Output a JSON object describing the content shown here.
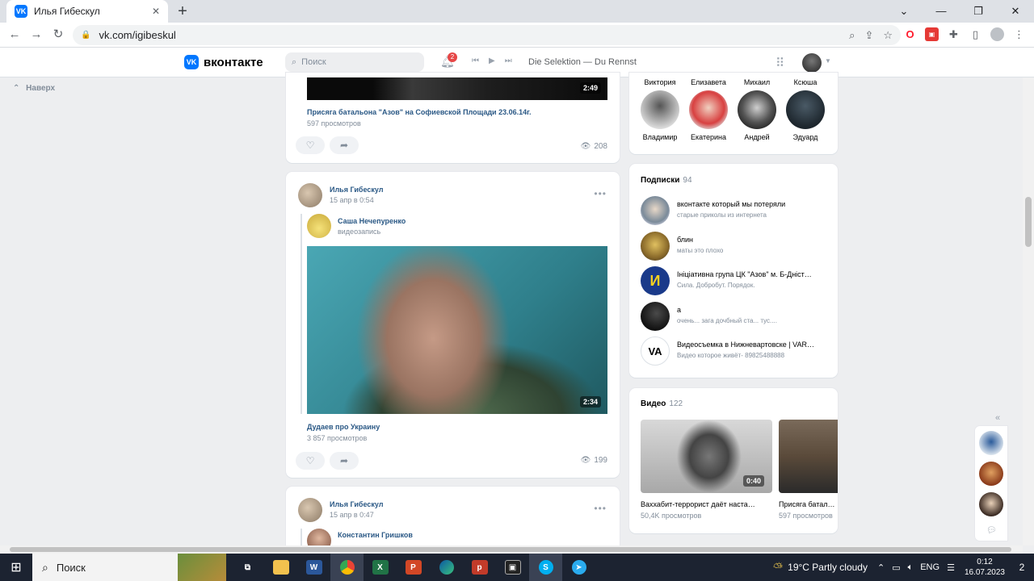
{
  "browser": {
    "tab_title": "Илья Гибескул",
    "tab_favicon": "VK",
    "url": "vk.com/igibeskul",
    "colors": {
      "tabbar": "#dee1e6",
      "omnibox": "#f1f3f4"
    }
  },
  "header": {
    "logo_text": "вконтакте",
    "logo_mark": "VK",
    "search_placeholder": "Поиск",
    "notifications_count": "2",
    "now_playing": "Die Selektion — Du Rennst",
    "accent": "#0077ff"
  },
  "left_nav": {
    "back_to_top": "Наверх"
  },
  "posts": [
    {
      "video_duration": "2:49",
      "video_title": "Присяга батальона \"Азов\" на Софиевской Площади 23.06.14г.",
      "video_views": "597 просмотров",
      "views": "208"
    },
    {
      "author": "Илья Гибескул",
      "date": "15 апр в 0:54",
      "repost_author": "Саша Нечепуренко",
      "repost_type": "видеозапись",
      "video_duration": "2:34",
      "video_title": "Дудаев про Украину",
      "video_views": "3 857 просмотров",
      "views": "199"
    },
    {
      "author": "Илья Гибескул",
      "date": "15 апр в 0:47",
      "repost_author": "Константин Гришков"
    }
  ],
  "friends": {
    "row_top": [
      "Виктория",
      "Елизавета",
      "Михаил",
      "Ксюша"
    ],
    "row_bottom": [
      "Владимир",
      "Екатерина",
      "Андрей",
      "Эдуард"
    ]
  },
  "subscriptions": {
    "title": "Подписки",
    "count": "94",
    "items": [
      {
        "name": "вконтакте который мы потеряли",
        "desc": "старые приколы из интернета"
      },
      {
        "name": "блин",
        "desc": "маты это плохо"
      },
      {
        "name": "Ініціативна група ЦК \"Азов\" м. Б-Дніст…",
        "desc": "Сила. Добробут. Порядок."
      },
      {
        "name": "а",
        "desc": "очень... зага дочбный ста... тус...."
      },
      {
        "name": "Видеосъемка в Нижневартовске | VAR…",
        "desc": "Видео которое живёт- 89825488888"
      }
    ]
  },
  "videos": {
    "title": "Видео",
    "count": "122",
    "items": [
      {
        "duration": "0:40",
        "title": "Ваххабит-террорист даёт наста…",
        "views": "50,4K просмотров"
      },
      {
        "title": "Присяга батал…",
        "views": "597 просмотров"
      }
    ]
  },
  "taskbar": {
    "search": "Поиск",
    "weather": "19°C  Partly cloudy",
    "lang": "ENG",
    "time": "0:12",
    "date": "16.07.2023",
    "notifications": "2"
  }
}
